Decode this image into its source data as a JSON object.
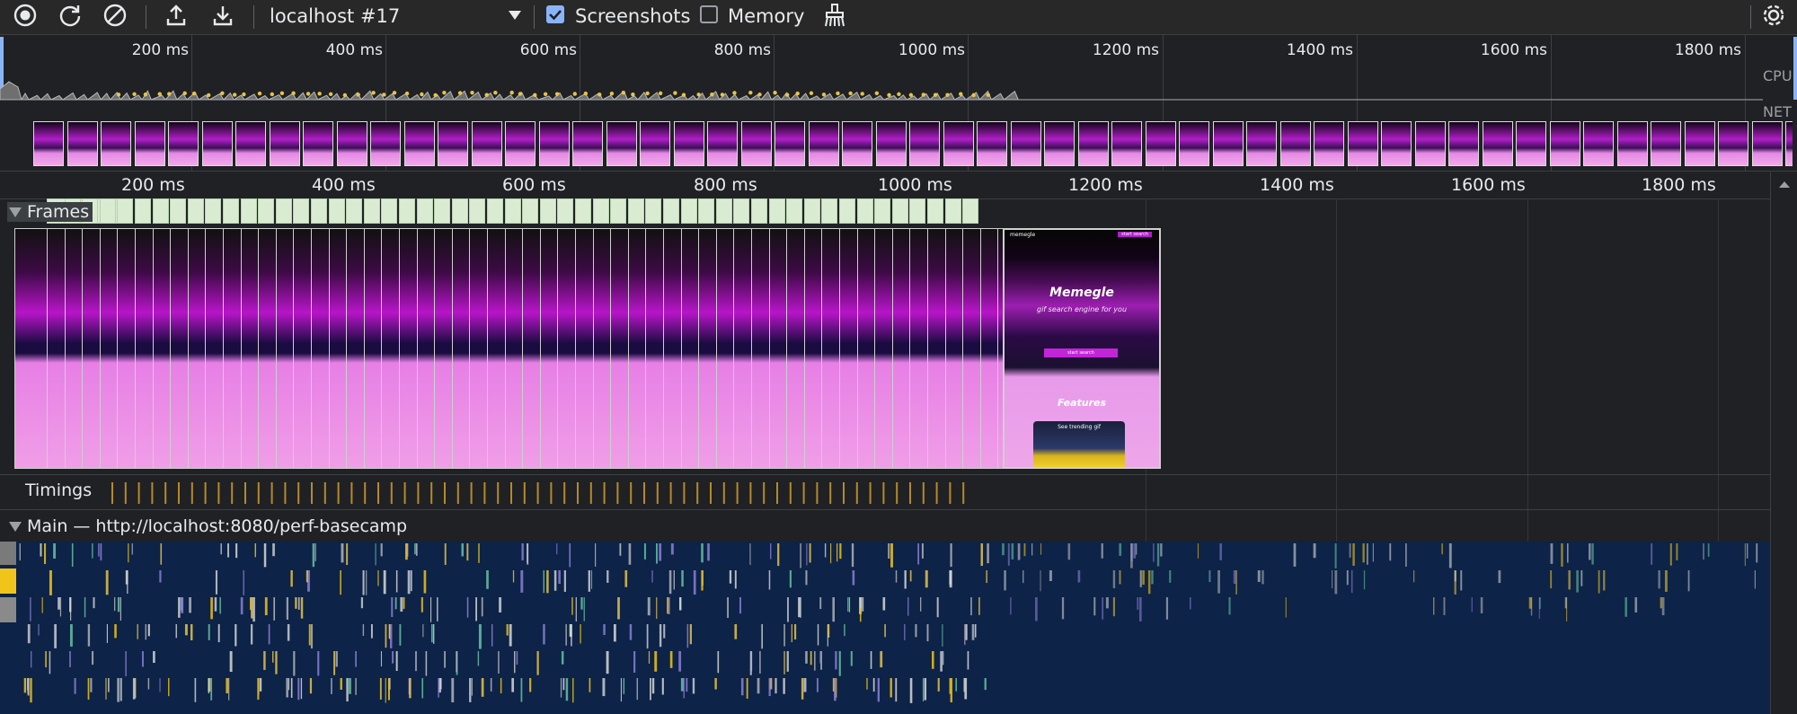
{
  "toolbar": {
    "record_icon": "record-icon",
    "reload_icon": "reload-icon",
    "clear_icon": "clear-icon",
    "upload_icon": "upload-icon",
    "download_icon": "download-icon",
    "profile_select": "localhost #17",
    "screenshots_label": "Screenshots",
    "screenshots_checked": true,
    "memory_label": "Memory",
    "memory_checked": false,
    "gc_icon": "garbage-collect-icon",
    "settings_icon": "gear-icon"
  },
  "overview": {
    "ticks": [
      "200 ms",
      "400 ms",
      "600 ms",
      "800 ms",
      "1000 ms",
      "1200 ms",
      "1400 ms",
      "1600 ms",
      "1800 ms"
    ],
    "cpu_label": "CPU",
    "net_label": "NET"
  },
  "ruler": {
    "ticks": [
      "200 ms",
      "400 ms",
      "600 ms",
      "800 ms",
      "1000 ms",
      "1200 ms",
      "1400 ms",
      "1600 ms",
      "1800 ms"
    ]
  },
  "tracks": {
    "frames_label": "Frames",
    "timings_label": "Timings",
    "main_label": "Main — http://localhost:8080/perf-basecamp"
  },
  "screenshot_preview": {
    "brand": "memegle",
    "cta_top": "start search",
    "title": "Memegle",
    "subtitle": "gif search engine for you",
    "button": "start search",
    "features_heading": "Features",
    "card_caption": "See trending gif"
  },
  "colors": {
    "toolbar_bg": "#282828",
    "panel_bg": "#202124",
    "checkbox_accent": "#8ab4f8",
    "frame_fill": "#d9ecd2",
    "timing_mark": "#b58a2a",
    "main_bg": "#0d2347",
    "task_yellow": "#f0c419"
  }
}
